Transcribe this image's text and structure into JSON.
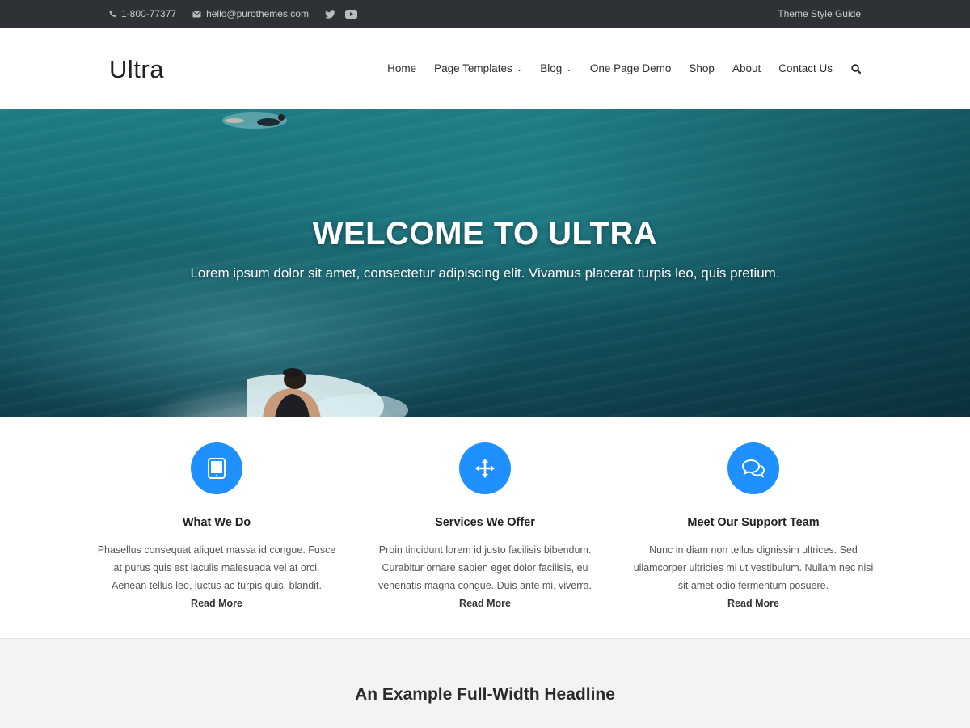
{
  "topbar": {
    "phone": "1-800-77377",
    "email": "hello@purothemes.com",
    "style_guide": "Theme Style Guide"
  },
  "header": {
    "logo": "Ultra",
    "nav": [
      {
        "label": "Home"
      },
      {
        "label": "Page Templates"
      },
      {
        "label": "Blog"
      },
      {
        "label": "One Page Demo"
      },
      {
        "label": "Shop"
      },
      {
        "label": "About"
      },
      {
        "label": "Contact Us"
      }
    ]
  },
  "hero": {
    "title": "WELCOME TO ULTRA",
    "subtitle": "Lorem ipsum dolor sit amet, consectetur adipiscing elit. Vivamus placerat turpis leo, quis pretium."
  },
  "features": [
    {
      "icon": "tablet-icon",
      "title": "What We Do",
      "text": "Phasellus consequat aliquet massa id congue. Fusce at purus quis est iaculis malesuada vel at orci. Aenean tellus leo, luctus ac turpis quis, blandit.",
      "more": "Read More"
    },
    {
      "icon": "move-arrows-icon",
      "title": "Services We Offer",
      "text": "Proin tincidunt lorem id justo facilisis bibendum. Curabitur ornare sapien eget dolor facilisis, eu venenatis magna congue. Duis ante mi, viverra.",
      "more": "Read More"
    },
    {
      "icon": "chat-bubbles-icon",
      "title": "Meet Our Support Team",
      "text": "Nunc in diam non tellus dignissim ultrices. Sed ullamcorper ultricies mi ut vestibulum. Nullam nec nisi sit amet odio fermentum posuere.",
      "more": "Read More"
    }
  ],
  "band": {
    "headline": "An Example Full-Width Headline"
  },
  "colors": {
    "accent": "#1e90ff",
    "topbar_bg": "#2e3135"
  }
}
